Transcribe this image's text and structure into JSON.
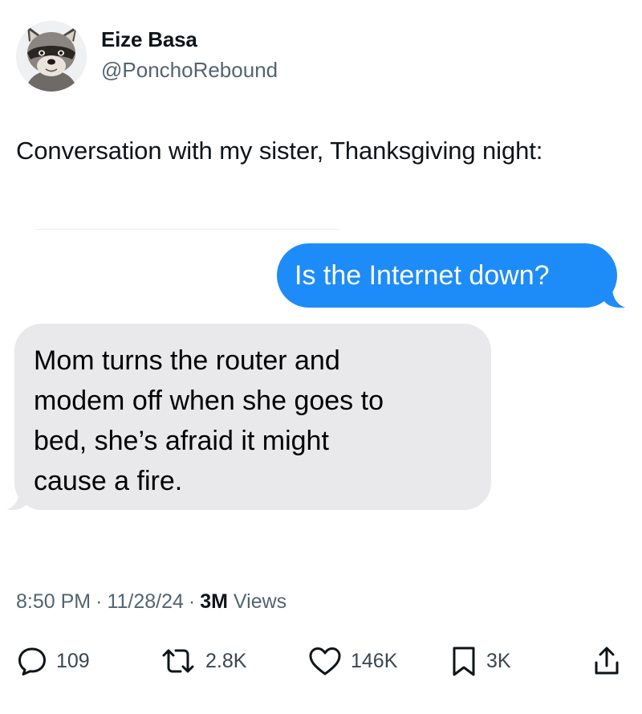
{
  "author": {
    "display_name": "Eize Basa",
    "handle": "@PonchoRebound",
    "avatar_icon": "raccoon-avatar"
  },
  "tweet": {
    "text": "Conversation with my sister, Thanksgiving night:"
  },
  "messages": {
    "sent": "Is the Internet down?",
    "received_lines": [
      "Mom turns the router and",
      "modem off when she goes to",
      "bed, she’s afraid it might",
      "cause a fire."
    ]
  },
  "meta": {
    "time": "8:50 PM",
    "date": "11/28/24",
    "views_count": "3M",
    "views_label": "Views"
  },
  "actions": {
    "replies": "109",
    "reposts": "2.8K",
    "likes": "146K",
    "bookmarks": "3K"
  },
  "colors": {
    "sent_bubble": "#1d8cf8",
    "received_bubble": "#e9e9eb",
    "secondary_text": "#536471"
  }
}
